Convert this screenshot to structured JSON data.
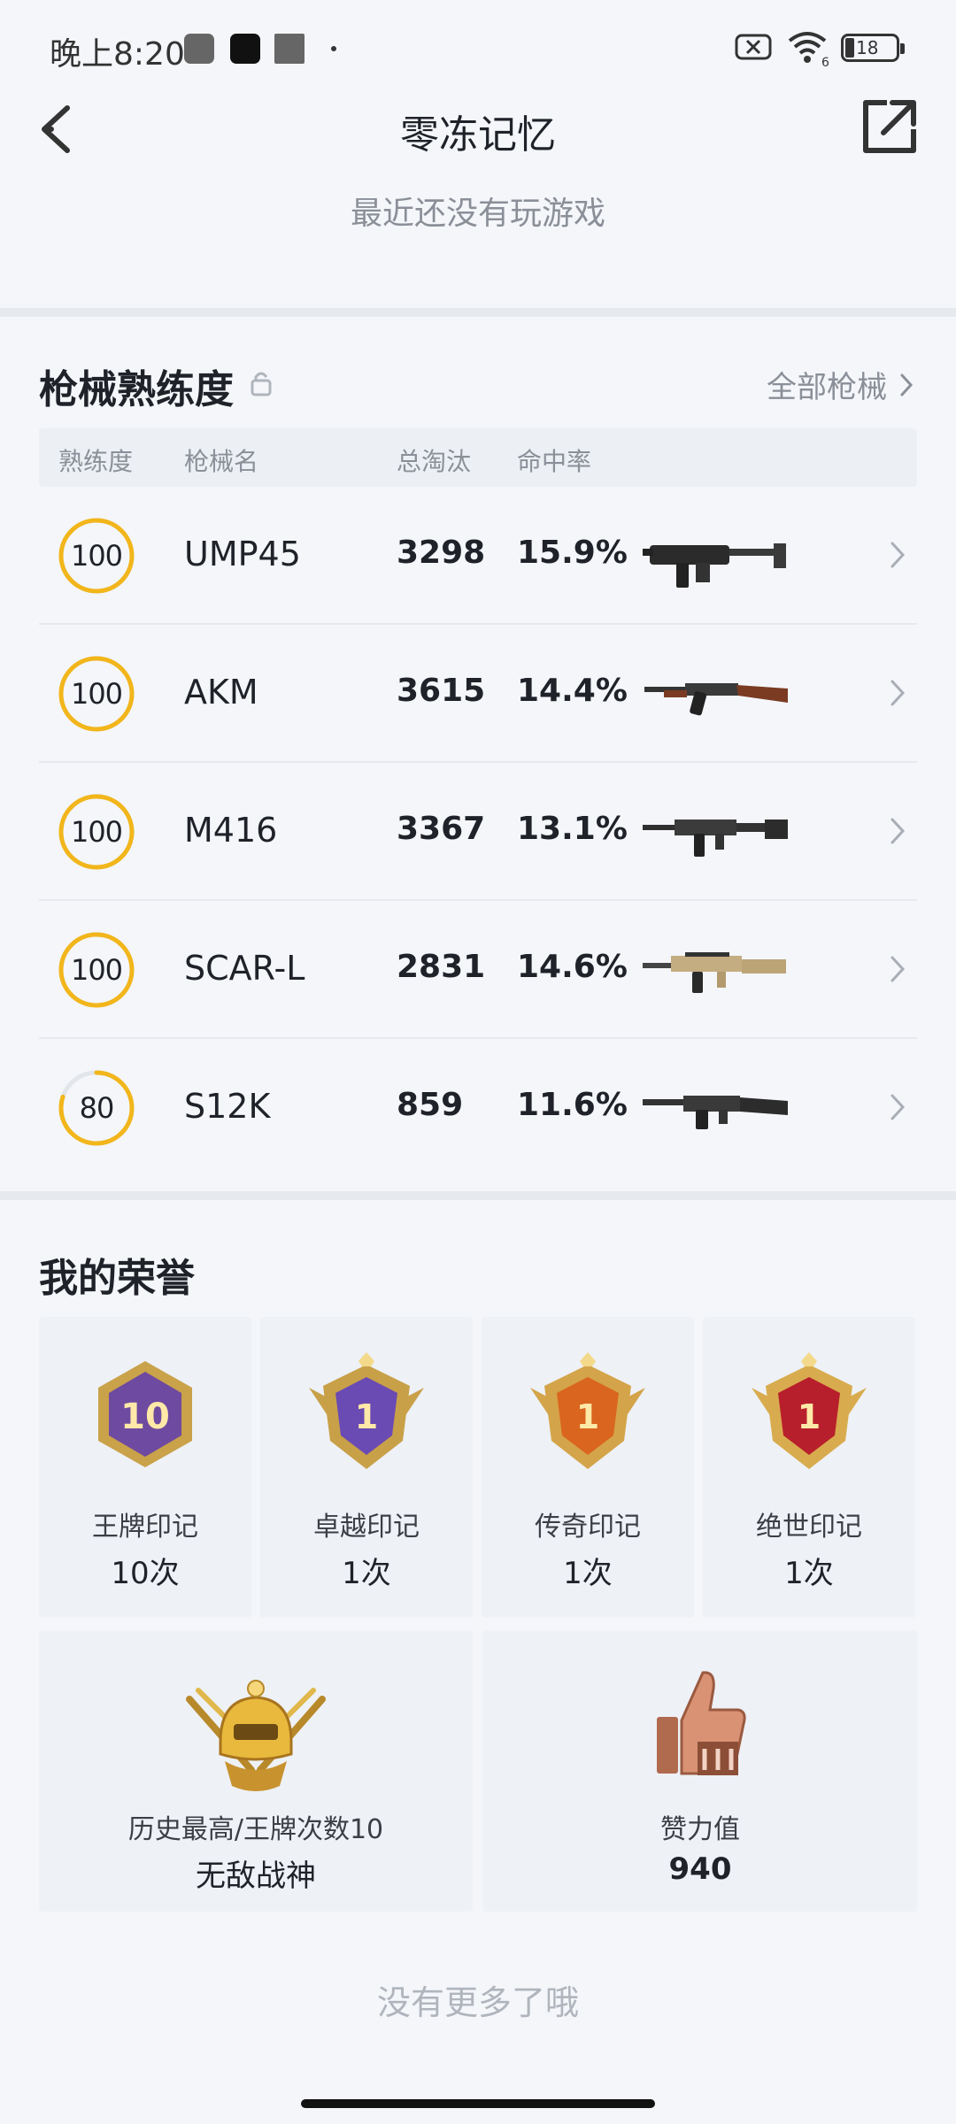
{
  "status_bar": {
    "time": "晚上8:20",
    "battery": "18",
    "wifi_badge": "6"
  },
  "header": {
    "title": "零冻记忆",
    "subtitle": "最近还没有玩游戏"
  },
  "weapons": {
    "title": "枪械熟练度",
    "all_link": "全部枪械",
    "columns": {
      "proficiency": "熟练度",
      "name": "枪械名",
      "kills": "总淘汰",
      "accuracy": "命中率"
    },
    "rows": [
      {
        "proficiency": "100",
        "level": 1.0,
        "name": "UMP45",
        "kills": "3298",
        "accuracy": "15.9%",
        "gun_icon": "smg-icon"
      },
      {
        "proficiency": "100",
        "level": 1.0,
        "name": "AKM",
        "kills": "3615",
        "accuracy": "14.4%",
        "gun_icon": "rifle-wood-icon"
      },
      {
        "proficiency": "100",
        "level": 1.0,
        "name": "M416",
        "kills": "3367",
        "accuracy": "13.1%",
        "gun_icon": "rifle-icon"
      },
      {
        "proficiency": "100",
        "level": 1.0,
        "name": "SCAR-L",
        "kills": "2831",
        "accuracy": "14.6%",
        "gun_icon": "rifle-tan-icon"
      },
      {
        "proficiency": "80",
        "level": 0.8,
        "name": "S12K",
        "kills": "859",
        "accuracy": "11.6%",
        "gun_icon": "shotgun-icon"
      }
    ],
    "ring_color": "#f2b61b"
  },
  "honors": {
    "title": "我的荣誉",
    "marks": [
      {
        "label": "王牌印记",
        "value": "10次",
        "badge_text": "10",
        "icon": "ace-mark-icon"
      },
      {
        "label": "卓越印记",
        "value": "1次",
        "badge_text": "1",
        "icon": "excellent-mark-icon"
      },
      {
        "label": "传奇印记",
        "value": "1次",
        "badge_text": "1",
        "icon": "legend-mark-icon"
      },
      {
        "label": "绝世印记",
        "value": "1次",
        "badge_text": "1",
        "icon": "peerless-mark-icon"
      }
    ],
    "best": {
      "label": "历史最高/王牌次数10",
      "value": "无敌战神",
      "icon": "conqueror-helmet-icon"
    },
    "likes": {
      "label": "赞力值",
      "value": "940",
      "icon": "thumbs-up-icon"
    }
  },
  "footer": {
    "note": "没有更多了哦"
  }
}
